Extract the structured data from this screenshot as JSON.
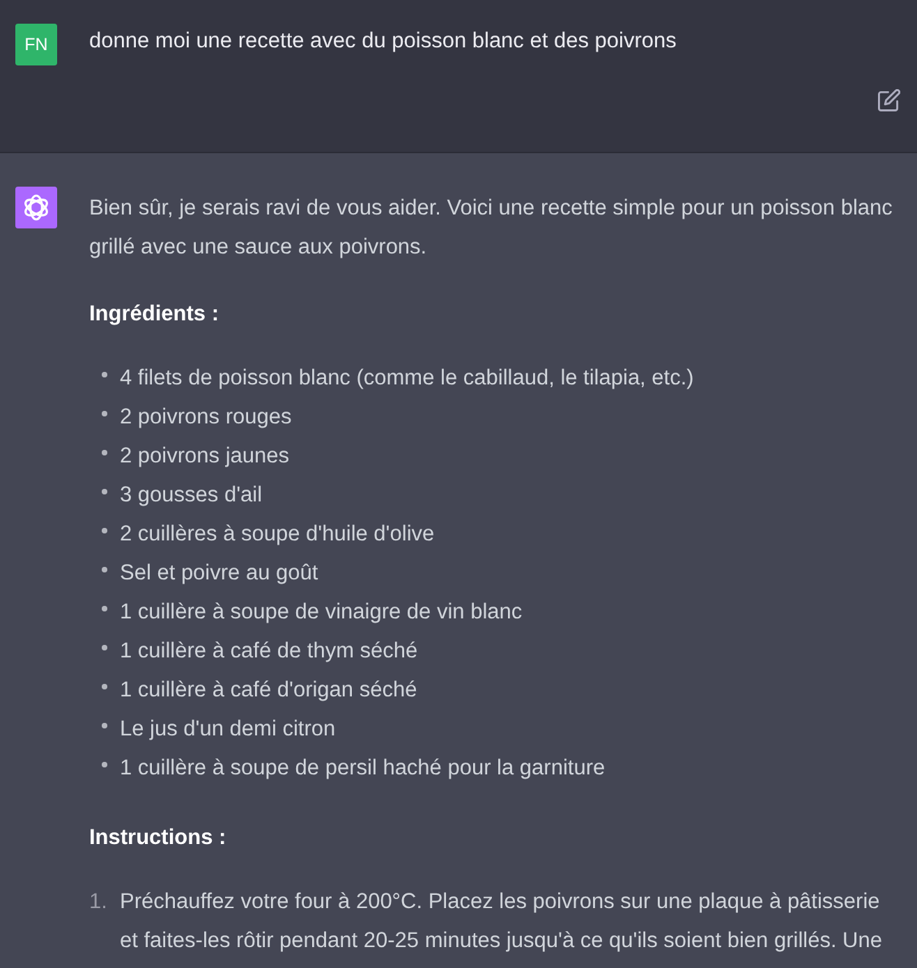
{
  "messages": [
    {
      "kind": "user",
      "avatar": "FN",
      "text": "donne moi une recette avec du poisson blanc et des poivrons"
    },
    {
      "kind": "assistant",
      "blocks": [
        {
          "kind": "paragraph",
          "text": "Bien sûr, je serais ravi de vous aider. Voici une recette simple pour un poisson blanc grillé avec une sauce aux poivrons."
        },
        {
          "kind": "heading",
          "text": "Ingrédients :"
        },
        {
          "kind": "bullets",
          "items": [
            "4 filets de poisson blanc (comme le cabillaud, le tilapia, etc.)",
            "2 poivrons rouges",
            "2 poivrons jaunes",
            "3 gousses d'ail",
            "2 cuillères à soupe d'huile d'olive",
            "Sel et poivre au goût",
            "1 cuillère à soupe de vinaigre de vin blanc",
            "1 cuillère à café de thym séché",
            "1 cuillère à café d'origan séché",
            "Le jus d'un demi citron",
            "1 cuillère à soupe de persil haché pour la garniture"
          ]
        },
        {
          "kind": "heading",
          "text": "Instructions :"
        },
        {
          "kind": "numbered",
          "items": [
            {
              "number": "1.",
              "text": "Préchauffez votre four à 200°C. Placez les poivrons sur une plaque à pâtisserie et faites-les rôtir pendant 20-25 minutes jusqu'à ce qu'ils soient bien grillés. Une"
            }
          ]
        }
      ]
    }
  ]
}
